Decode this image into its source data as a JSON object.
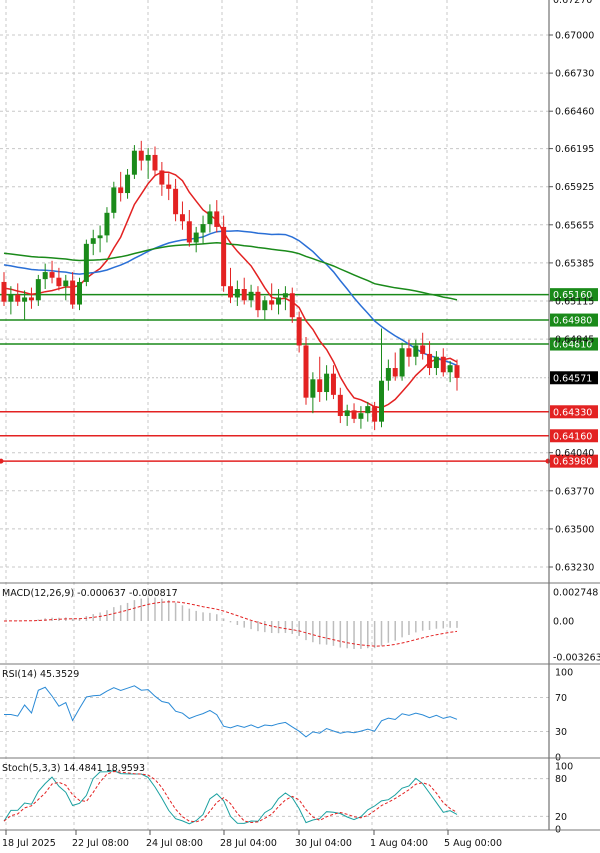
{
  "chart_data": {
    "type": "candlestick",
    "price_axis": {
      "ticks": [
        "0.67000",
        "0.66730",
        "0.66460",
        "0.66195",
        "0.65925",
        "0.65655",
        "0.65385",
        "0.65115",
        "0.64845",
        "0.64040",
        "0.63770",
        "0.63500",
        "0.63230"
      ],
      "top_partial": "0.67270",
      "ylim": [
        0.631,
        0.6735
      ]
    },
    "x_labels": [
      "18 Jul 2025",
      "22 Jul 08:00",
      "24 Jul 08:00",
      "28 Jul 04:00",
      "30 Jul 04:00",
      "1 Aug 04:00",
      "5 Aug 00:00"
    ],
    "levels": [
      {
        "value": "0.65160",
        "color": "#1a8a1a",
        "text_color": "#ffffff"
      },
      {
        "value": "0.64980",
        "color": "#1a8a1a",
        "text_color": "#ffffff"
      },
      {
        "value": "0.64810",
        "color": "#1a8a1a",
        "text_color": "#ffffff"
      },
      {
        "value": "0.64330",
        "color": "#e32222",
        "text_color": "#ffffff"
      },
      {
        "value": "0.64160",
        "color": "#e32222",
        "text_color": "#ffffff"
      },
      {
        "value": "0.63980",
        "color": "#e32222",
        "text_color": "#ffffff"
      }
    ],
    "current_price": "0.64571",
    "colors": {
      "up": "#1a8a1a",
      "down": "#e32222",
      "ma_fast": "#e32222",
      "ma_mid": "#2a6fd6",
      "ma_slow": "#1a8a1a",
      "grid": "#c8c8c8"
    },
    "candles": [
      [
        0.6525,
        0.6532,
        0.6508,
        0.6511
      ],
      [
        0.6511,
        0.6522,
        0.6502,
        0.6516
      ],
      [
        0.6516,
        0.6524,
        0.6508,
        0.6511
      ],
      [
        0.6511,
        0.6519,
        0.6498,
        0.6514
      ],
      [
        0.6514,
        0.6521,
        0.6506,
        0.6512
      ],
      [
        0.6512,
        0.653,
        0.6508,
        0.6527
      ],
      [
        0.6527,
        0.6538,
        0.652,
        0.6532
      ],
      [
        0.6532,
        0.654,
        0.6524,
        0.6528
      ],
      [
        0.6528,
        0.6535,
        0.6519,
        0.6522
      ],
      [
        0.6522,
        0.653,
        0.6512,
        0.6526
      ],
      [
        0.6526,
        0.6532,
        0.6506,
        0.6509
      ],
      [
        0.6509,
        0.6528,
        0.6505,
        0.6525
      ],
      [
        0.6525,
        0.6555,
        0.6522,
        0.6552
      ],
      [
        0.6552,
        0.6562,
        0.6544,
        0.6556
      ],
      [
        0.6556,
        0.6565,
        0.6546,
        0.6558
      ],
      [
        0.6558,
        0.6578,
        0.6553,
        0.6574
      ],
      [
        0.6574,
        0.6596,
        0.657,
        0.6592
      ],
      [
        0.6592,
        0.6603,
        0.6582,
        0.6588
      ],
      [
        0.6588,
        0.6605,
        0.6584,
        0.6601
      ],
      [
        0.6601,
        0.6622,
        0.6598,
        0.6618
      ],
      [
        0.6618,
        0.6625,
        0.6604,
        0.6611
      ],
      [
        0.6611,
        0.662,
        0.6598,
        0.6615
      ],
      [
        0.6615,
        0.6621,
        0.66,
        0.6604
      ],
      [
        0.6604,
        0.661,
        0.6586,
        0.6594
      ],
      [
        0.6594,
        0.6602,
        0.6583,
        0.6591
      ],
      [
        0.6591,
        0.6598,
        0.6568,
        0.6573
      ],
      [
        0.6573,
        0.6582,
        0.6562,
        0.6568
      ],
      [
        0.6568,
        0.6576,
        0.655,
        0.6553
      ],
      [
        0.6553,
        0.6564,
        0.6546,
        0.656
      ],
      [
        0.656,
        0.6572,
        0.6552,
        0.6566
      ],
      [
        0.6566,
        0.658,
        0.656,
        0.6575
      ],
      [
        0.6575,
        0.6583,
        0.656,
        0.6564
      ],
      [
        0.6564,
        0.6572,
        0.6518,
        0.6522
      ],
      [
        0.6522,
        0.6535,
        0.651,
        0.6514
      ],
      [
        0.6514,
        0.6526,
        0.6508,
        0.652
      ],
      [
        0.652,
        0.6528,
        0.6509,
        0.6512
      ],
      [
        0.6512,
        0.6523,
        0.6507,
        0.6518
      ],
      [
        0.6518,
        0.6522,
        0.65,
        0.6505
      ],
      [
        0.6505,
        0.6515,
        0.6498,
        0.6512
      ],
      [
        0.6512,
        0.6524,
        0.6505,
        0.6509
      ],
      [
        0.6509,
        0.652,
        0.6502,
        0.6514
      ],
      [
        0.6514,
        0.6522,
        0.6505,
        0.6517
      ],
      [
        0.6517,
        0.6521,
        0.6496,
        0.65
      ],
      [
        0.65,
        0.6504,
        0.6475,
        0.648
      ],
      [
        0.648,
        0.6486,
        0.6438,
        0.6443
      ],
      [
        0.6443,
        0.6461,
        0.6432,
        0.6456
      ],
      [
        0.6456,
        0.6472,
        0.644,
        0.6447
      ],
      [
        0.6447,
        0.6466,
        0.6441,
        0.646
      ],
      [
        0.646,
        0.6466,
        0.6442,
        0.6445
      ],
      [
        0.6445,
        0.645,
        0.6425,
        0.643
      ],
      [
        0.643,
        0.6438,
        0.6423,
        0.6434
      ],
      [
        0.6434,
        0.6439,
        0.6425,
        0.6428
      ],
      [
        0.6428,
        0.6437,
        0.6421,
        0.6432
      ],
      [
        0.6432,
        0.644,
        0.6426,
        0.6437
      ],
      [
        0.6437,
        0.644,
        0.642,
        0.6426
      ],
      [
        0.6426,
        0.6492,
        0.6422,
        0.6455
      ],
      [
        0.6455,
        0.647,
        0.6448,
        0.6464
      ],
      [
        0.6464,
        0.6475,
        0.6455,
        0.6458
      ],
      [
        0.6458,
        0.6482,
        0.6455,
        0.6478
      ],
      [
        0.6478,
        0.6484,
        0.6465,
        0.6472
      ],
      [
        0.6472,
        0.6484,
        0.6466,
        0.648
      ],
      [
        0.648,
        0.6489,
        0.647,
        0.6474
      ],
      [
        0.6474,
        0.6483,
        0.6459,
        0.6464
      ],
      [
        0.6464,
        0.6476,
        0.6459,
        0.6472
      ],
      [
        0.6472,
        0.6478,
        0.6458,
        0.6461
      ],
      [
        0.6461,
        0.6469,
        0.6454,
        0.6466
      ],
      [
        0.6466,
        0.647,
        0.6448,
        0.6457
      ]
    ],
    "indicators": {
      "macd": {
        "label": "MACD(12,26,9) -0.000637 -0.000817",
        "ticks": [
          "0.002748",
          "0.00",
          "-0.003263"
        ]
      },
      "rsi": {
        "label": "RSI(14) 45.3529",
        "ticks": [
          "100",
          "70",
          "30",
          "0"
        ]
      },
      "stoch": {
        "label": "Stoch(5,3,3) 14.4841 18.9593",
        "ticks": [
          "100",
          "80",
          "20",
          "0"
        ]
      }
    }
  }
}
